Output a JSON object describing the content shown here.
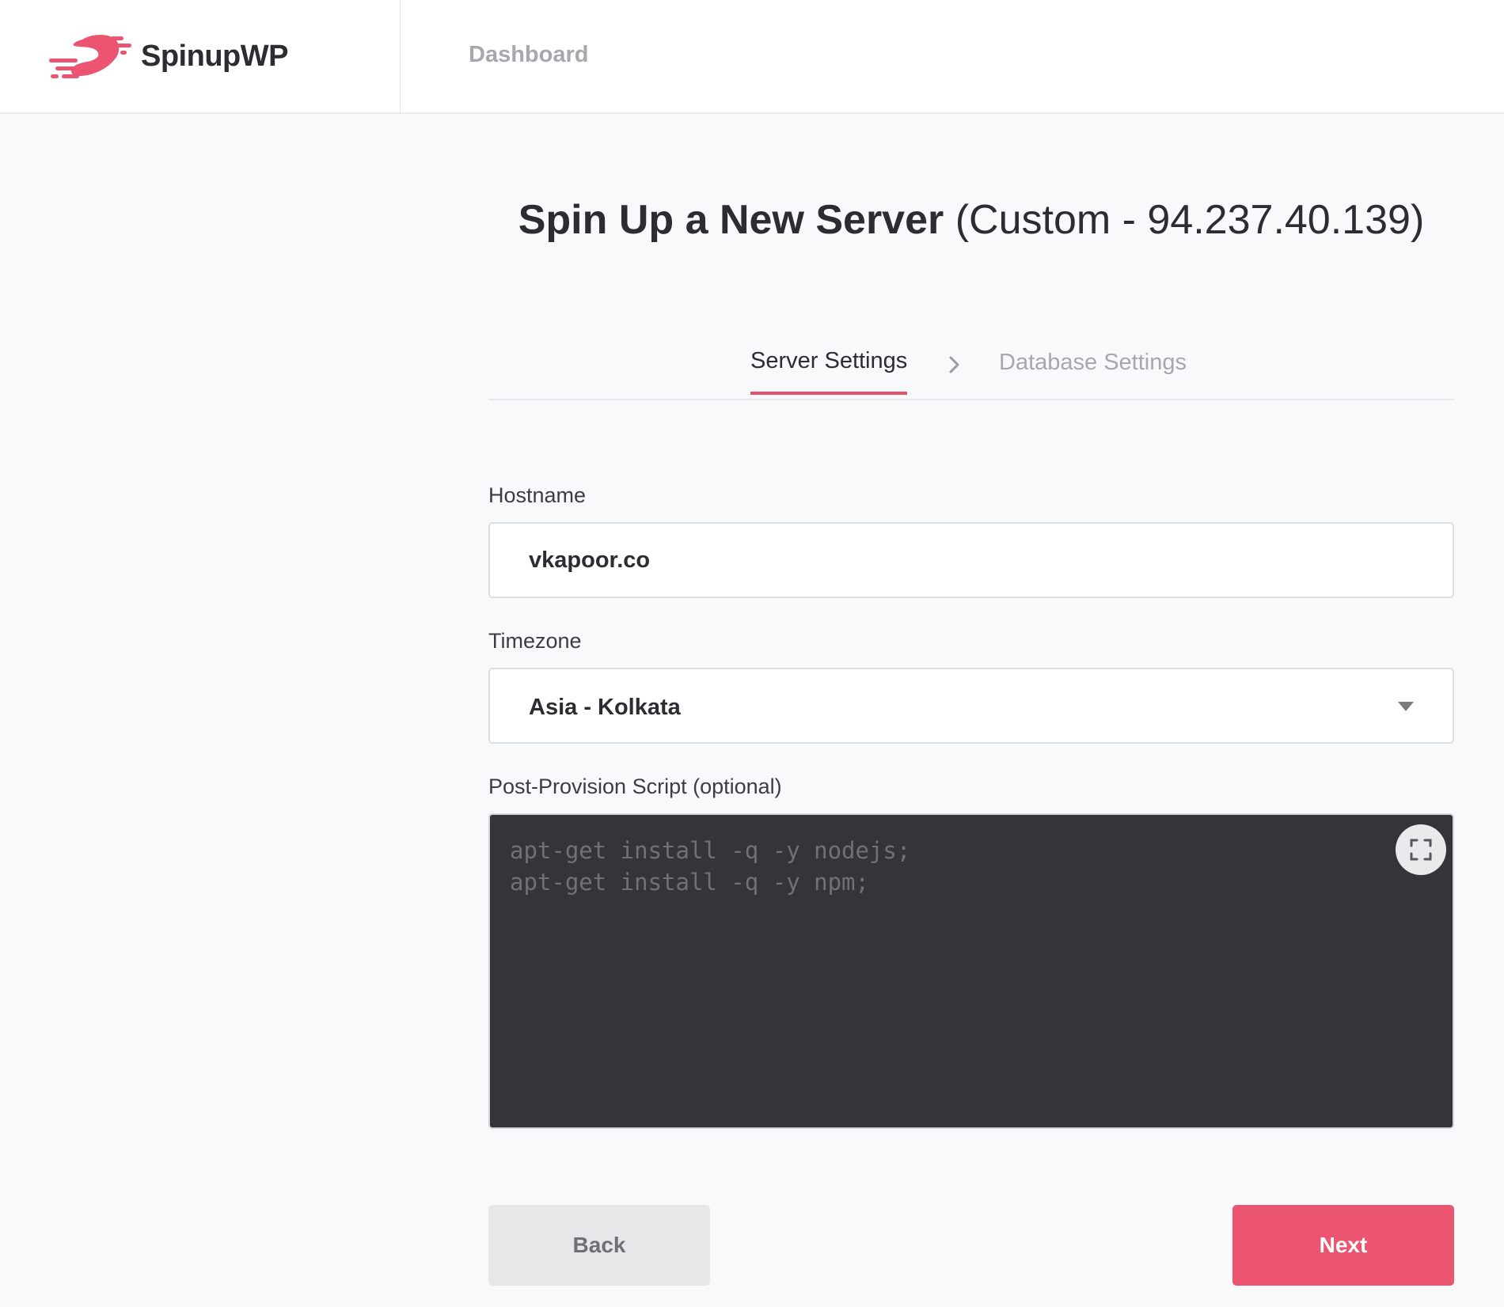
{
  "header": {
    "brand_name": "SpinupWP",
    "nav_dashboard": "Dashboard"
  },
  "page": {
    "title_main": "Spin Up a New Server",
    "title_sub": " (Custom - 94.237.40.139)"
  },
  "steps": {
    "active": "Server Settings",
    "next": "Database Settings"
  },
  "form": {
    "hostname_label": "Hostname",
    "hostname_value": "vkapoor.co",
    "timezone_label": "Timezone",
    "timezone_value": "Asia - Kolkata",
    "script_label": "Post-Provision Script (optional)",
    "script_lines": [
      "apt-get install -q -y nodejs;",
      "apt-get install -q -y npm;"
    ]
  },
  "actions": {
    "back_label": "Back",
    "next_label": "Next"
  },
  "colors": {
    "accent": "#eb5571",
    "text": "#2b2d33",
    "muted": "#a6a8ad",
    "editor_bg": "#34353a"
  },
  "icons": {
    "logo": "spinupwp-logo-icon",
    "step_separator": "chevron-right-icon",
    "select_caret": "caret-down-icon",
    "fullscreen": "fullscreen-icon"
  }
}
